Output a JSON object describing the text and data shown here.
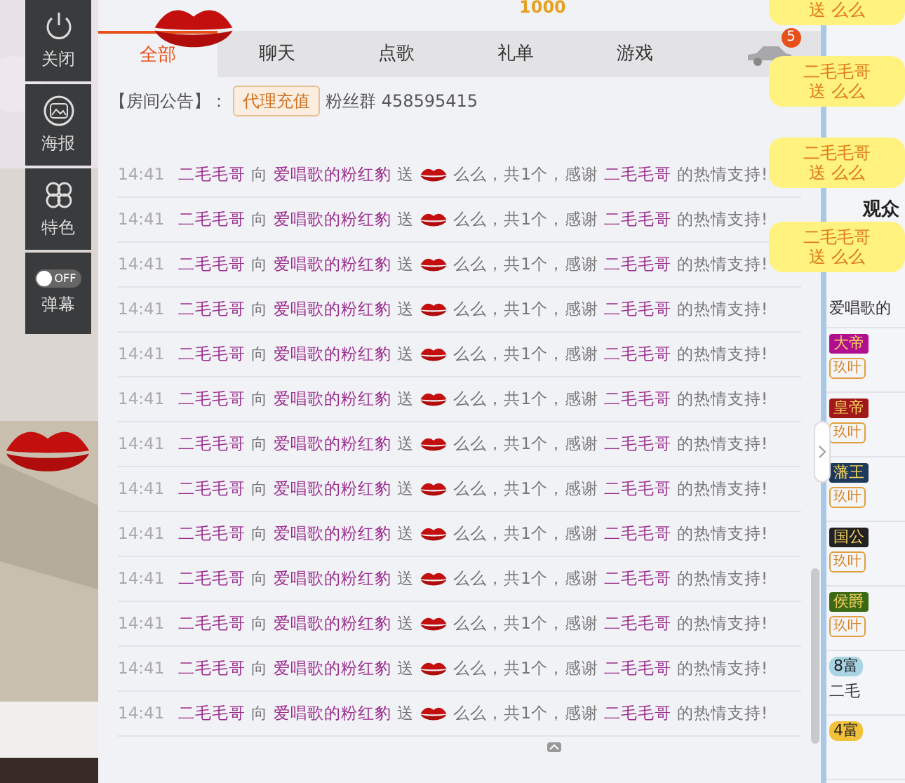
{
  "sidebar": [
    {
      "kind": "power",
      "label": "关闭"
    },
    {
      "kind": "poster",
      "label": "海报"
    },
    {
      "kind": "feature",
      "label": "特色"
    },
    {
      "kind": "toggle",
      "label": "弹幕",
      "toggle_text": "OFF",
      "on": false
    }
  ],
  "header": {
    "coins": "1000"
  },
  "tabs": [
    {
      "label": "全部",
      "selected": true
    },
    {
      "label": "聊天",
      "selected": false
    },
    {
      "label": "点歌",
      "selected": false
    },
    {
      "label": "礼单",
      "selected": false
    },
    {
      "label": "游戏",
      "selected": false
    }
  ],
  "car_badge": "5",
  "notice": {
    "label": "【房间公告】：",
    "tag": "代理充值",
    "text": "粉丝群 458595415"
  },
  "messages": [
    {
      "time": "14:41",
      "sender": "二毛毛哥",
      "to_word": "向",
      "receiver": "爱唱歌的粉红豹",
      "give_word": "送",
      "gift": "么么，共1个，感谢",
      "thanked": "二毛毛哥",
      "tail": "的热情支持!"
    },
    {
      "time": "14:41",
      "sender": "二毛毛哥",
      "to_word": "向",
      "receiver": "爱唱歌的粉红豹",
      "give_word": "送",
      "gift": "么么，共1个，感谢",
      "thanked": "二毛毛哥",
      "tail": "的热情支持!"
    },
    {
      "time": "14:41",
      "sender": "二毛毛哥",
      "to_word": "向",
      "receiver": "爱唱歌的粉红豹",
      "give_word": "送",
      "gift": "么么，共1个，感谢",
      "thanked": "二毛毛哥",
      "tail": "的热情支持!"
    },
    {
      "time": "14:41",
      "sender": "二毛毛哥",
      "to_word": "向",
      "receiver": "爱唱歌的粉红豹",
      "give_word": "送",
      "gift": "么么，共1个，感谢",
      "thanked": "二毛毛哥",
      "tail": "的热情支持!"
    },
    {
      "time": "14:41",
      "sender": "二毛毛哥",
      "to_word": "向",
      "receiver": "爱唱歌的粉红豹",
      "give_word": "送",
      "gift": "么么，共1个，感谢",
      "thanked": "二毛毛哥",
      "tail": "的热情支持!"
    },
    {
      "time": "14:41",
      "sender": "二毛毛哥",
      "to_word": "向",
      "receiver": "爱唱歌的粉红豹",
      "give_word": "送",
      "gift": "么么，共1个，感谢",
      "thanked": "二毛毛哥",
      "tail": "的热情支持!"
    },
    {
      "time": "14:41",
      "sender": "二毛毛哥",
      "to_word": "向",
      "receiver": "爱唱歌的粉红豹",
      "give_word": "送",
      "gift": "么么，共1个，感谢",
      "thanked": "二毛毛哥",
      "tail": "的热情支持!"
    },
    {
      "time": "14:41",
      "sender": "二毛毛哥",
      "to_word": "向",
      "receiver": "爱唱歌的粉红豹",
      "give_word": "送",
      "gift": "么么，共1个，感谢",
      "thanked": "二毛毛哥",
      "tail": "的热情支持!"
    },
    {
      "time": "14:41",
      "sender": "二毛毛哥",
      "to_word": "向",
      "receiver": "爱唱歌的粉红豹",
      "give_word": "送",
      "gift": "么么，共1个，感谢",
      "thanked": "二毛毛哥",
      "tail": "的热情支持!"
    },
    {
      "time": "14:41",
      "sender": "二毛毛哥",
      "to_word": "向",
      "receiver": "爱唱歌的粉红豹",
      "give_word": "送",
      "gift": "么么，共1个，感谢",
      "thanked": "二毛毛哥",
      "tail": "的热情支持!"
    },
    {
      "time": "14:41",
      "sender": "二毛毛哥",
      "to_word": "向",
      "receiver": "爱唱歌的粉红豹",
      "give_word": "送",
      "gift": "么么，共1个，感谢",
      "thanked": "二毛毛哥",
      "tail": "的热情支持!"
    },
    {
      "time": "14:41",
      "sender": "二毛毛哥",
      "to_word": "向",
      "receiver": "爱唱歌的粉红豹",
      "give_word": "送",
      "gift": "么么，共1个，感谢",
      "thanked": "二毛毛哥",
      "tail": "的热情支持!"
    },
    {
      "time": "14:41",
      "sender": "二毛毛哥",
      "to_word": "向",
      "receiver": "爱唱歌的粉红豹",
      "give_word": "送",
      "gift": "么么，共1个，感谢",
      "thanked": "二毛毛哥",
      "tail": "的热情支持!"
    }
  ],
  "toasts": [
    {
      "action": "送 么么"
    },
    {
      "name": "二毛毛哥",
      "action": "送 么么"
    },
    {
      "name": "二毛毛哥",
      "action": "送 么么"
    },
    {
      "name": "二毛毛哥",
      "action": "送 么么"
    }
  ],
  "audience": {
    "title": "观众",
    "items": [
      {
        "kind": "text",
        "text": "爱唱歌的"
      },
      {
        "kind": "rank",
        "rank": "大帝",
        "color": "#b0108f",
        "tag": "玖叶"
      },
      {
        "kind": "rank",
        "rank": "皇帝",
        "color": "#a01818",
        "tag": "玖叶"
      },
      {
        "kind": "rank",
        "rank": "藩王",
        "color": "#1e3a5a",
        "tag": "玖叶"
      },
      {
        "kind": "rank",
        "rank": "国公",
        "color": "#222222",
        "tag": "玖叶"
      },
      {
        "kind": "rank",
        "rank": "侯爵",
        "color": "#3c6a14",
        "tag": "玖叶"
      },
      {
        "kind": "wealth",
        "rank": "8富",
        "color": "#a8d4e4",
        "name": "二毛"
      },
      {
        "kind": "wealth",
        "rank": "4富",
        "color": "#f2c13a"
      }
    ]
  }
}
